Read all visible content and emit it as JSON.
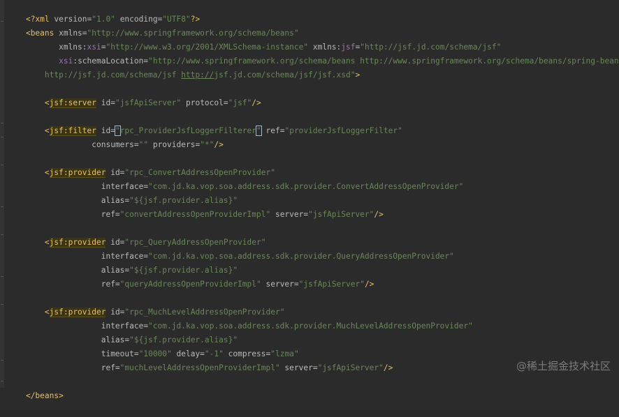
{
  "watermark": "@稀土掘金技术社区",
  "colors": {
    "background": "#2b2b2b",
    "tag": "#e8bf6a",
    "attribute": "#bababa",
    "namespace_prefix": "#9876aa",
    "string_value": "#6a8759",
    "text": "#a9b7c6"
  },
  "lines": {
    "l1": {
      "a": "<?xml ",
      "b": "version=",
      "c": "\"1.0\"",
      "d": " encoding=",
      "e": "\"UTF8\"",
      "f": "?>"
    },
    "l2": {
      "a": "<beans ",
      "b": "xmlns=",
      "c": "\"http://www.springframework.org/schema/beans\""
    },
    "l3": {
      "a": "       xmlns",
      "b": ":",
      "c": "xsi",
      "d": "=",
      "e": "\"http://www.w3.org/2001/XMLSchema-instance\"",
      "f": " xmlns",
      "g": ":",
      "h": "jsf",
      "i": "=",
      "j": "\"http://jsf.jd.com/schema/jsf\""
    },
    "l4": {
      "a": "       ",
      "b": "xsi",
      "c": ":schemaLocation=",
      "d": "\"http://www.springframework.org/schema/beans http://www.springframework.org/schema/beans/spring-beans.xsd"
    },
    "l5": {
      "a": "    http://jsf.jd.com/schema/jsf ",
      "b": "http://",
      "c": "jsf.jd.com/schema/jsf/jsf.xsd\"",
      "d": ">"
    },
    "l7": {
      "a": "    <",
      "b": "jsf:server",
      "c": " id=",
      "d": "\"jsfApiServer\"",
      "e": " protocol=",
      "f": "\"jsf\"",
      "g": "/>"
    },
    "l9": {
      "a": "    <",
      "b": "jsf:filter",
      "c": " id=",
      "d": "\"",
      "e": "rpc_ProviderJsfLoggerFilterer",
      "f": "\"",
      "g": " ref=",
      "h": "\"providerJsfLoggerFilter\""
    },
    "l10": {
      "a": "              consumers=",
      "b": "\"\"",
      "c": " providers=",
      "d": "\"*\"",
      "e": "/>"
    },
    "l12": {
      "a": "    <",
      "b": "jsf:provider",
      "c": " id=",
      "d": "\"rpc_ConvertAddressOpenProvider\""
    },
    "l13": {
      "a": "                interface=",
      "b": "\"com.jd.ka.vop.soa.address.sdk.provider.ConvertAddressOpenProvider\""
    },
    "l14": {
      "a": "                alias=",
      "b": "\"${jsf.provider.alias}\""
    },
    "l15": {
      "a": "                ref=",
      "b": "\"convertAddressOpenProviderImpl\"",
      "c": " server=",
      "d": "\"jsfApiServer\"",
      "e": "/>"
    },
    "l17": {
      "a": "    <",
      "b": "jsf:provider",
      "c": " id=",
      "d": "\"rpc_QueryAddressOpenProvider\""
    },
    "l18": {
      "a": "                interface=",
      "b": "\"com.jd.ka.vop.soa.address.sdk.provider.QueryAddressOpenProvider\""
    },
    "l19": {
      "a": "                alias=",
      "b": "\"${jsf.provider.alias}\""
    },
    "l20": {
      "a": "                ref=",
      "b": "\"queryAddressOpenProviderImpl\"",
      "c": " server=",
      "d": "\"jsfApiServer\"",
      "e": "/>"
    },
    "l22": {
      "a": "    <",
      "b": "jsf:provider",
      "c": " id=",
      "d": "\"rpc_MuchLevelAddressOpenProvider\""
    },
    "l23": {
      "a": "                interface=",
      "b": "\"com.jd.ka.vop.soa.address.sdk.provider.MuchLevelAddressOpenProvider\""
    },
    "l24": {
      "a": "                alias=",
      "b": "\"${jsf.provider.alias}\""
    },
    "l25": {
      "a": "                timeout=",
      "b": "\"10000\"",
      "c": " delay=",
      "d": "\"-1\"",
      "e": " compress=",
      "f": "\"lzma\""
    },
    "l26": {
      "a": "                ref=",
      "b": "\"muchLevelAddressOpenProviderImpl\"",
      "c": " server=",
      "d": "\"jsfApiServer\"",
      "e": "/>"
    },
    "l28": {
      "a": "</beans>"
    }
  }
}
